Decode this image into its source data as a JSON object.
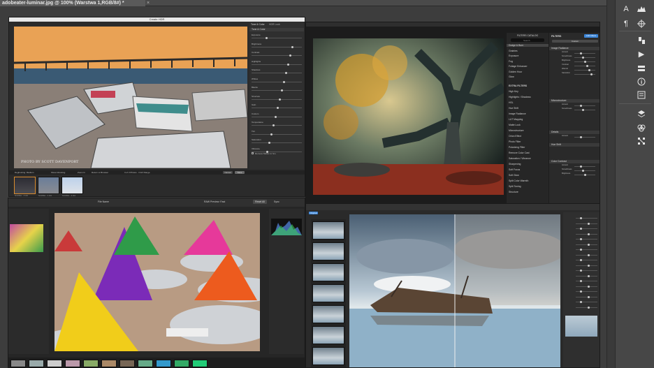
{
  "app": {
    "doc_tab": "adobeater-luminar.jpg @ 100% (Warstwa 1,RGB/8#) *",
    "close_glyph": "×"
  },
  "sidebar": {
    "icons": [
      "type-A-icon",
      "paragraph-icon",
      "histogram-icon",
      "navigator-icon",
      "brush-icon",
      "play-icon",
      "adjustments-icon",
      "info-icon",
      "properties-icon",
      "layers-icon",
      "channels-icon",
      "paths-icon"
    ],
    "glyphs": {
      "type": "A",
      "para": "¶",
      "play": "▶",
      "info": "i"
    }
  },
  "win1": {
    "title": "Create HDR",
    "panel_tabs": [
      "Tone & Color",
      "HDR Look"
    ],
    "section": "Tone & Color",
    "sliders": [
      "Exposure",
      "Brightness",
      "Contrast",
      "Highlights",
      "Shadows",
      "Whites",
      "Blacks",
      "Structure",
      "Gain",
      "Custom",
      "Temperature",
      "Tint",
      "Saturation",
      "Vibrance"
    ],
    "checkbox": "Remove Motion in Sm",
    "photo_caption": "PHOTO BY SCOTT DAVENPORT",
    "bottom": {
      "left": "Deghosting: Medium",
      "show_ghosting": "Show Ghosting",
      "zoom": "Zoom In",
      "return": "Return to Browser",
      "count": "3 of 3 Photos · 0 EV Range",
      "cancel": "Cancel",
      "save": "Save"
    },
    "thumbs": [
      "ScottDav...-0.dng",
      "ScottDav...-1.dng",
      "ScottDav...-2.dng"
    ],
    "thumb_ev": [
      "EV -2.0",
      "EV 0.0",
      "EV +2.0"
    ]
  },
  "win2": {
    "panel_title": "FILTERS CATALOG",
    "search": "Search",
    "catalog": [
      "Dodge & Burn",
      "Grainies",
      "Exposure",
      "Fog",
      "Foliage Enhancer",
      "Golden Hour",
      "Glow"
    ],
    "extra_title": "EXTRA FILTERS",
    "extra": [
      "High Key",
      "Highlights / Shadows",
      "HSL",
      "Hue Shift",
      "Image Radiance",
      "LUT Mapping",
      "Matte Look",
      "Microstructure",
      "Orton Effect",
      "Photo Filter",
      "Polarizing Filter",
      "Remove Color Cast",
      "Saturation / Vibrance",
      "Sharpening",
      "Soft Focus",
      "Soft Glow",
      "Split Color Warmth",
      "Split Toning",
      "Structure"
    ],
    "filters_label": "FILTERS",
    "add_filters": "Add Filters",
    "custom": "Custom",
    "right_sections": [
      "Image Radiance",
      "Microstructure",
      "Details",
      "Hue Shift",
      "Color Contrast"
    ],
    "right_sliders": [
      "Amount",
      "Smoothness",
      "Brightness",
      "Contrast",
      "Warmth",
      "Saturation"
    ],
    "save_btn": "Save Filters Preset"
  },
  "win3": {
    "top": [
      "File Name",
      "RAW Preview: Fast",
      "Reset All",
      "Sync"
    ],
    "subtabs": [
      "Adjust",
      "Edit",
      "Browse"
    ]
  },
  "win4": {
    "tabs": [
      "Original",
      "Edit"
    ]
  },
  "colors": {
    "sunset": "#d08c4a",
    "sky_blue": "#7d9bb0"
  }
}
